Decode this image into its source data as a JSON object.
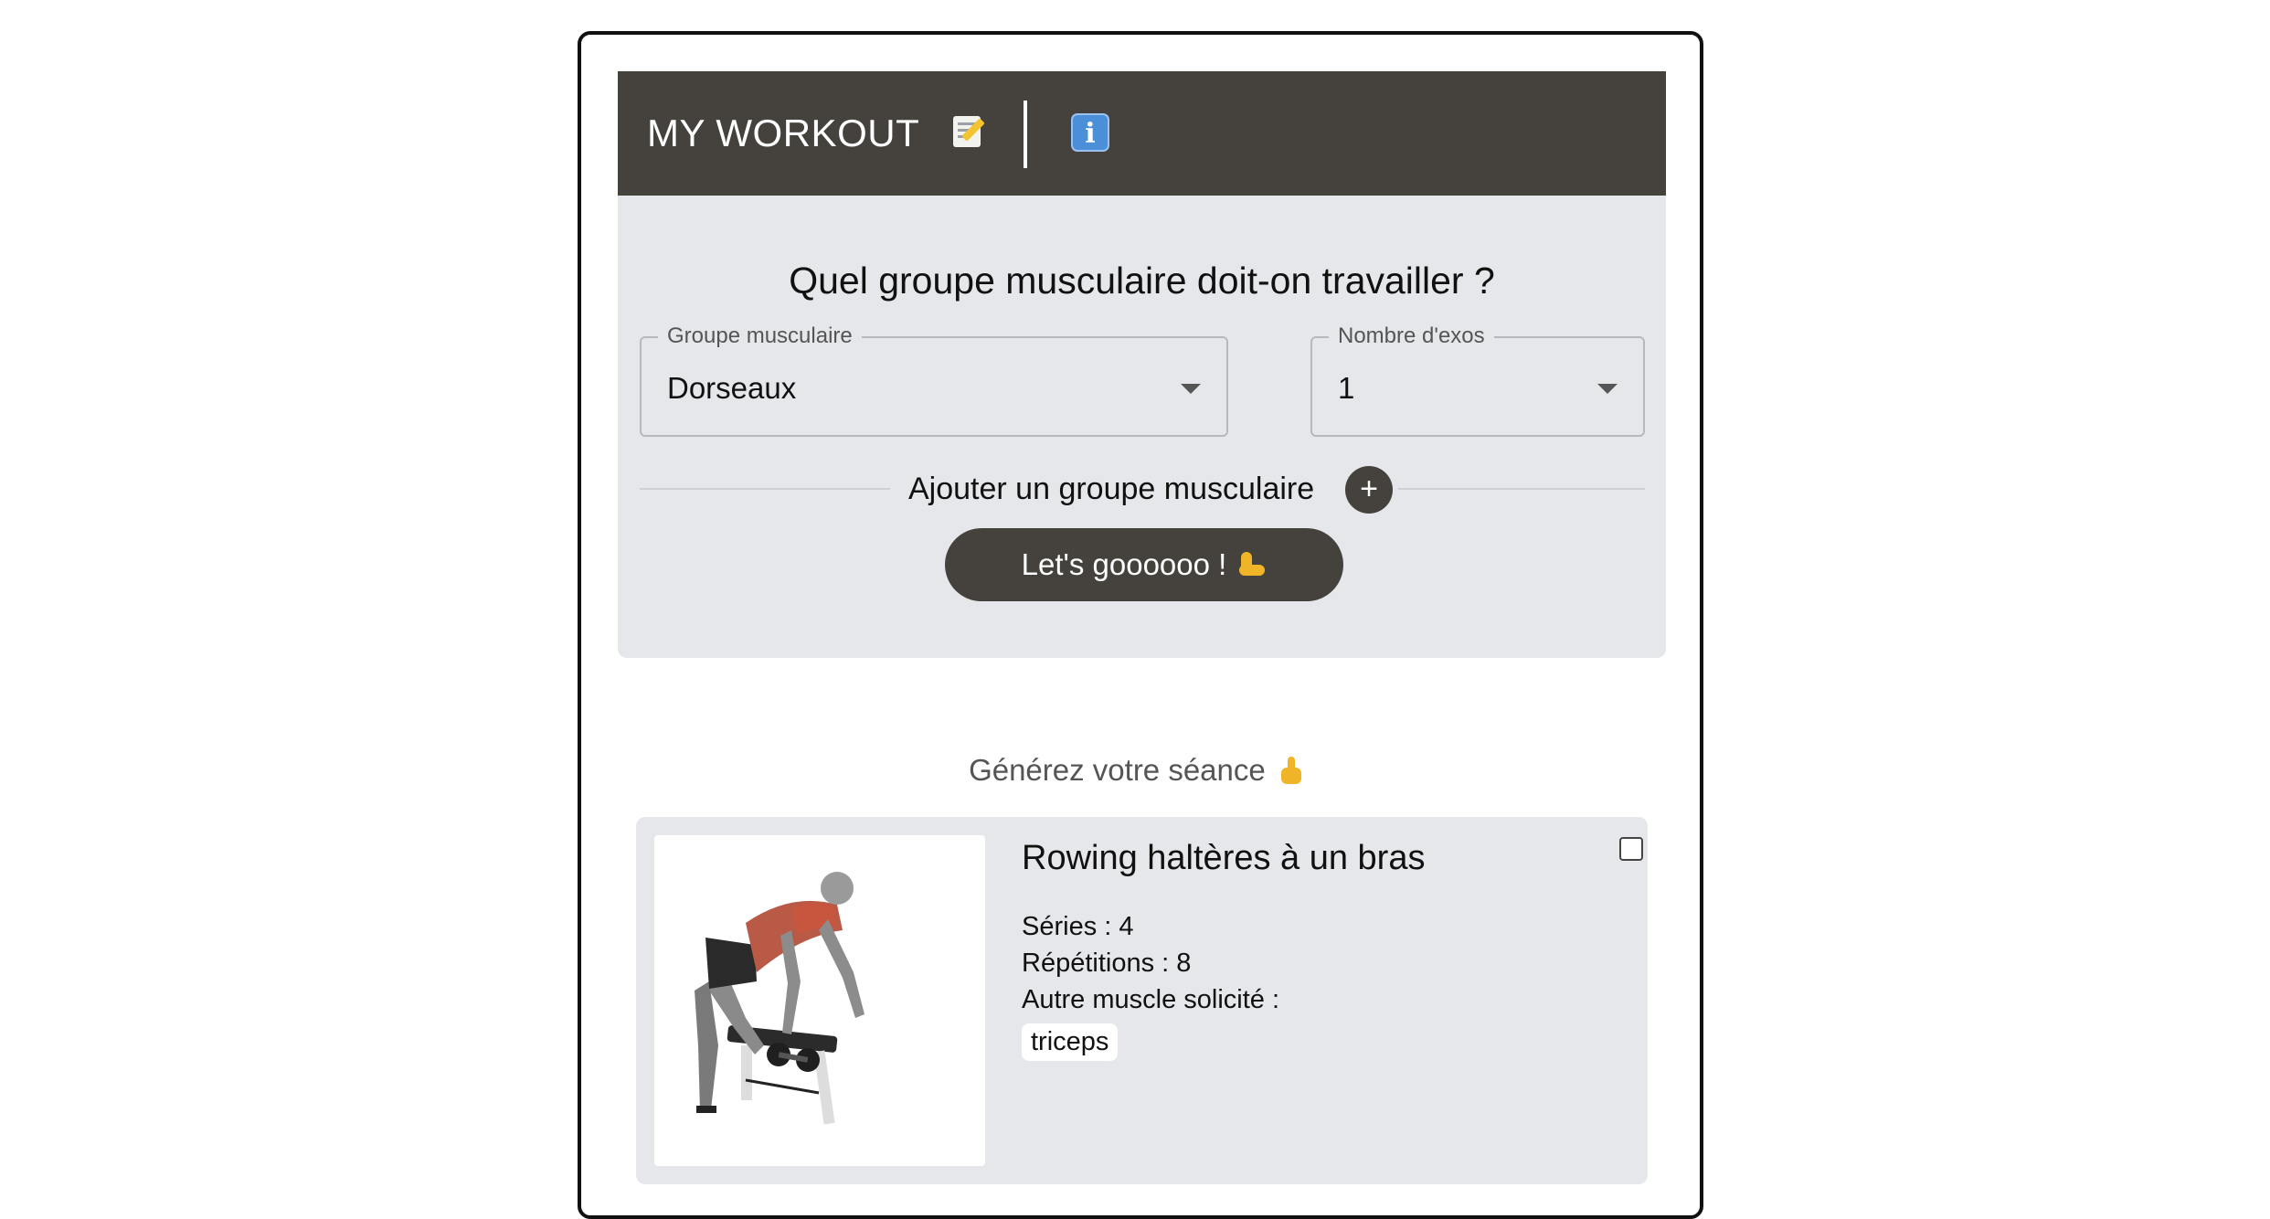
{
  "header": {
    "title": "MY WORKOUT",
    "icons": [
      "notepad-pencil-icon",
      "info-icon"
    ],
    "info_glyph": "i"
  },
  "form": {
    "question": "Quel groupe musculaire doit-on travailler ?",
    "muscle_group": {
      "label": "Groupe musculaire",
      "value": "Dorseaux"
    },
    "exercise_count": {
      "label": "Nombre d'exos",
      "value": "1"
    },
    "add_group_label": "Ajouter un groupe musculaire",
    "add_button_glyph": "+",
    "go_button_label": "Let's goooooo !"
  },
  "session": {
    "prompt": "Générez votre séance"
  },
  "exercise_card": {
    "title": "Rowing haltères à un bras",
    "series": "Séries : 4",
    "reps": "Répétitions : 8",
    "other_muscle_label": "Autre muscle solicité :",
    "tags": [
      "triceps"
    ],
    "checked": false
  },
  "colors": {
    "header_bg": "#45423e",
    "panel_bg": "#e6e7ea",
    "accent_muscle": "#c8563f"
  }
}
